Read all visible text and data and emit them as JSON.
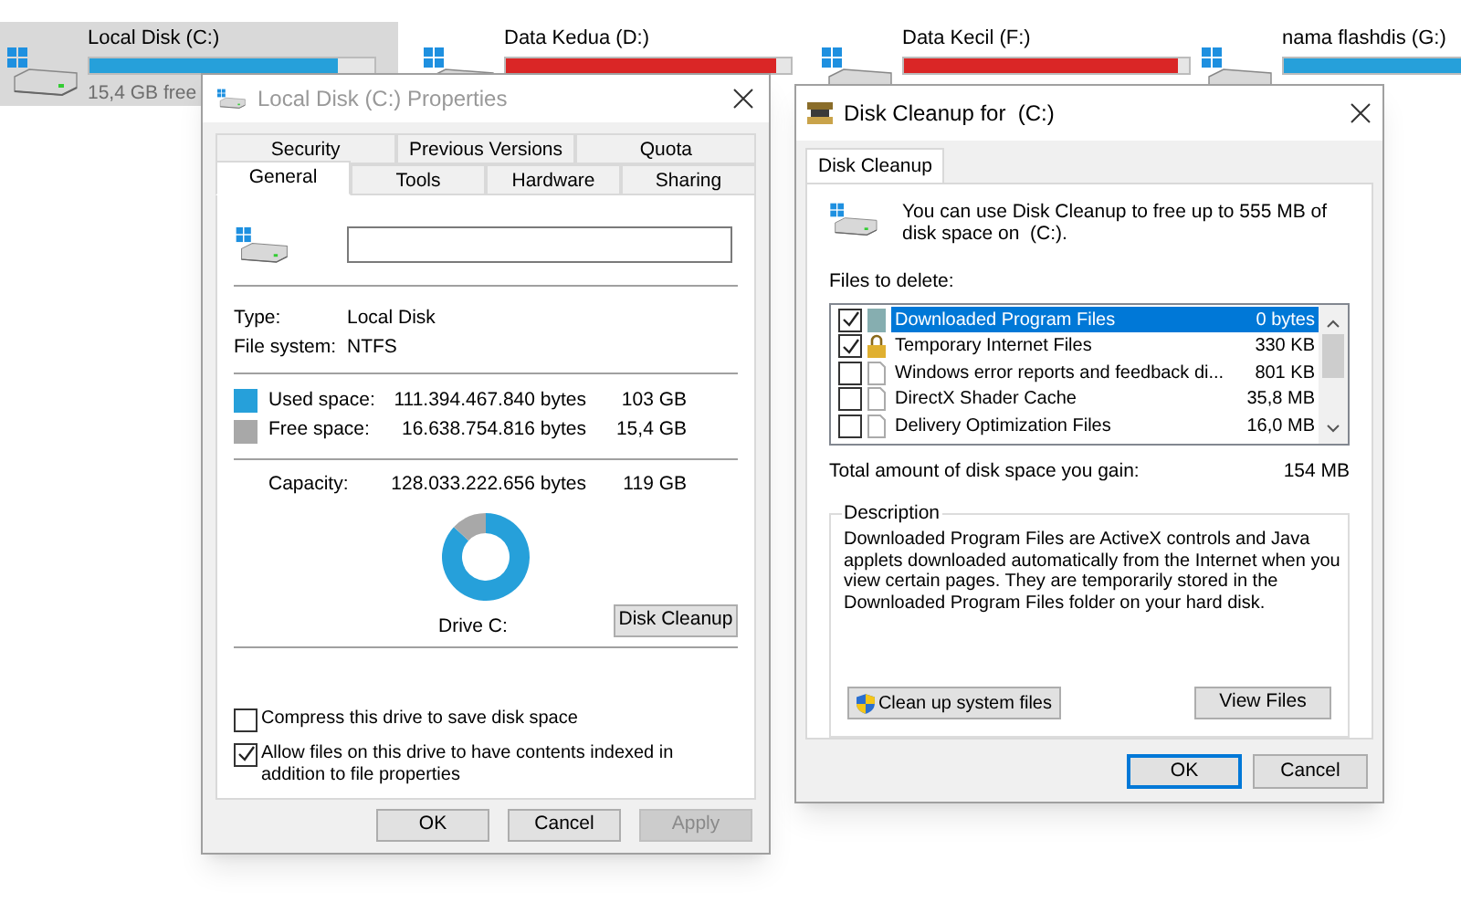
{
  "drives": [
    {
      "name": "Local Disk (C:)",
      "free_text": "15,4 GB free",
      "level": 0.87,
      "color": "#26a0da",
      "selected": true
    },
    {
      "name": "Data Kedua (D:)",
      "level": 0.95,
      "color": "#da2626",
      "selected": false
    },
    {
      "name": "Data Kecil (F:)",
      "level": 0.96,
      "color": "#da2626",
      "selected": false
    },
    {
      "name": "nama flashdis (G:)",
      "level": 0.67,
      "color": "#26a0da",
      "selected": false
    }
  ],
  "properties_window": {
    "title": "Local Disk (C:) Properties",
    "tab_rows": [
      [
        {
          "label": "Security",
          "selected": false
        },
        {
          "label": "Previous Versions",
          "selected": false
        },
        {
          "label": "Quota",
          "selected": false
        }
      ],
      [
        {
          "label": "General",
          "selected": true
        },
        {
          "label": "Tools",
          "selected": false
        },
        {
          "label": "Hardware",
          "selected": false
        },
        {
          "label": "Sharing",
          "selected": false
        }
      ]
    ],
    "info": [
      {
        "label": "Type:",
        "value": "Local Disk"
      },
      {
        "label": "File system:",
        "value": "NTFS"
      }
    ],
    "space": [
      {
        "label": "Used space:",
        "bytes": "111.394.467.840 bytes",
        "size": "103 GB",
        "color": "#26a0da"
      },
      {
        "label": "Free space:",
        "bytes": "16.638.754.816 bytes",
        "size": "15,4 GB",
        "color": "#a8a8a8"
      }
    ],
    "capacity": {
      "label": "Capacity:",
      "bytes": "128.033.222.656 bytes",
      "size": "119 GB"
    },
    "chart_data": {
      "type": "donut",
      "values": [
        87,
        13
      ]
    },
    "drive_label": "Drive C:",
    "cleanup_button": "Disk Cleanup",
    "options": [
      {
        "label": "Compress this drive to save disk space",
        "checked": false
      },
      {
        "label": "Allow files on this drive to have contents indexed in addition to file properties",
        "checked": true
      }
    ],
    "buttons": [
      {
        "label": "OK",
        "disabled": false
      },
      {
        "label": "Cancel",
        "disabled": false
      },
      {
        "label": "Apply",
        "disabled": true
      }
    ]
  },
  "cleanup_window": {
    "title": "Disk Cleanup for  (C:)",
    "tab": "Disk Cleanup",
    "intro": "You can use Disk Cleanup to free up to 555 MB of disk space on  (C:).",
    "files_label": "Files to delete:",
    "files": [
      {
        "name": "Downloaded Program Files",
        "size": "0 bytes",
        "checked": true,
        "selected": true,
        "kind": "folder"
      },
      {
        "name": "Temporary Internet Files",
        "size": "330 KB",
        "checked": true,
        "selected": false,
        "kind": "lock"
      },
      {
        "name": "Windows error reports and feedback di...",
        "size": "801 KB",
        "checked": false,
        "selected": false,
        "kind": "document"
      },
      {
        "name": "DirectX Shader Cache",
        "size": "35,8 MB",
        "checked": false,
        "selected": false,
        "kind": "document"
      },
      {
        "name": "Delivery Optimization Files",
        "size": "16,0 MB",
        "checked": false,
        "selected": false,
        "kind": "document"
      }
    ],
    "total_label": "Total amount of disk space you gain:",
    "total": "154 MB",
    "description_title": "Description",
    "description": "Downloaded Program Files are ActiveX controls and Java applets downloaded automatically from the Internet when you view certain pages. They are temporarily stored in the Downloaded Program Files folder on your hard disk.",
    "system_button": "Clean up system files",
    "view_button": "View Files",
    "buttons": [
      {
        "label": "OK",
        "default": true
      },
      {
        "label": "Cancel",
        "default": false
      }
    ]
  }
}
